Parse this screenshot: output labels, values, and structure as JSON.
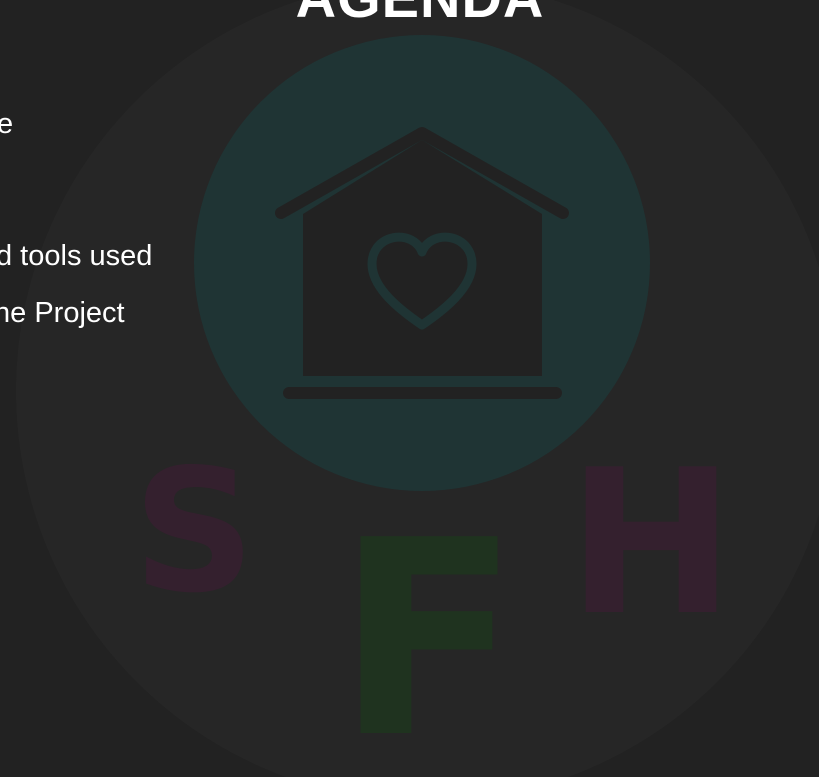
{
  "slide": {
    "title": "AGENDA",
    "agenda_lines": [
      "e",
      "d tools used",
      "he Project"
    ]
  },
  "logo": {
    "letters": [
      "S",
      "F",
      "H"
    ],
    "icon": "house-heart-icon",
    "colors": {
      "background": "#222222",
      "circle_outer": "#262626",
      "circle_inner": "#1f3434",
      "house": "#222222",
      "letter_s": "#34202e",
      "letter_f": "#1f331f",
      "letter_h": "#34202e"
    }
  }
}
